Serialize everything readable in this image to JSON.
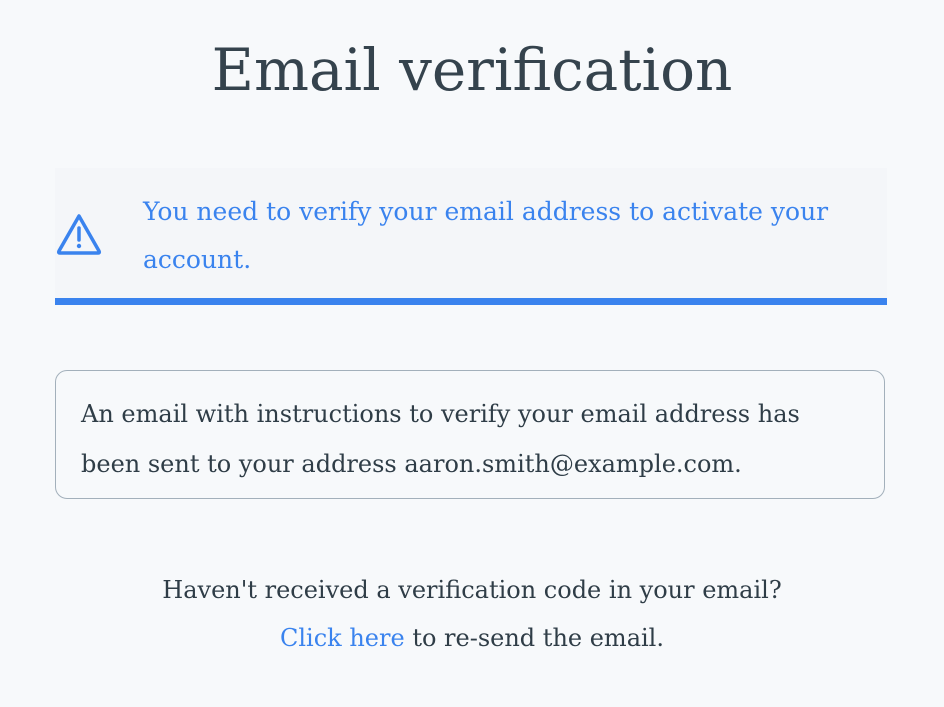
{
  "page": {
    "title": "Email verification"
  },
  "alert": {
    "icon": "warning-triangle-icon",
    "message": "You need to verify your email address to activate your account.",
    "accent_color": "#3a83ee"
  },
  "info": {
    "message": "An email with instructions to verify your email address has been sent to your address aaron.smith@example.com."
  },
  "resend": {
    "prompt": "Haven't received a verification code in your email?",
    "link_label": "Click here",
    "suffix": " to re-send the email."
  }
}
